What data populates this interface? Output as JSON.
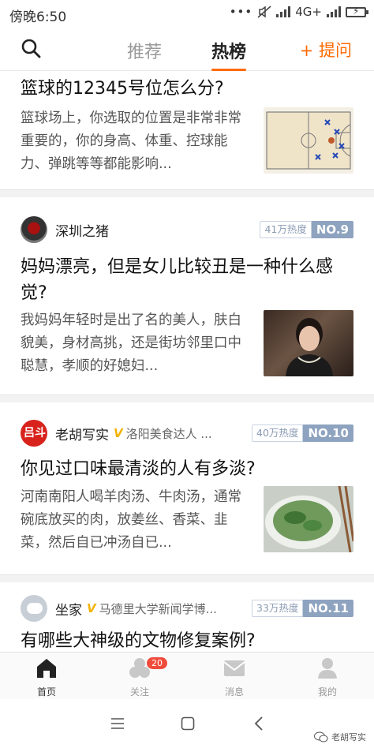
{
  "status_bar": {
    "time": "傍晚6:50",
    "network": "4G+"
  },
  "top_nav": {
    "tabs": [
      {
        "label": "推荐",
        "active": false
      },
      {
        "label": "热榜",
        "active": true
      }
    ],
    "ask_button": "+ 提问",
    "accent_color": "#ff6a00"
  },
  "feed": [
    {
      "title": "篮球的12345号位怎么分?",
      "excerpt": "篮球场上，你选取的位置是非常非常重要的，你的身高、体重、控球能力、弹跳等等都能影响...",
      "thumbnail": "basketball-court-diagram"
    },
    {
      "author": {
        "name": "深圳之猪",
        "verified": false,
        "desc": ""
      },
      "heat": {
        "value": "41万热度",
        "rank": "NO.9"
      },
      "title": "妈妈漂亮，但是女儿比较丑是一种什么感觉?",
      "excerpt": "我妈妈年轻时是出了名的美人，肤白貌美，身材高挑，还是街坊邻里口中聪慧，孝顺的好媳妇...",
      "thumbnail": "woman-portrait-photo"
    },
    {
      "author": {
        "name": "老胡写实",
        "verified": true,
        "verified_mark": "V",
        "desc": "洛阳美食达人 ..."
      },
      "heat": {
        "value": "40万热度",
        "rank": "NO.10"
      },
      "title": "你见过口味最清淡的人有多淡?",
      "excerpt": "河南南阳人喝羊肉汤、牛肉汤，通常碗底放买的肉，放姜丝、香菜、韭菜，然后自已冲汤自已...",
      "thumbnail": "soup-bowl-photo"
    },
    {
      "author": {
        "name": "坐家",
        "verified": true,
        "verified_mark": "V",
        "desc": "马德里大学新闻学博..."
      },
      "heat": {
        "value": "33万热度",
        "rank": "NO.11"
      },
      "title": "有哪些大神级的文物修复案例?"
    }
  ],
  "tab_bar": {
    "items": [
      {
        "label": "首页",
        "icon": "home-icon",
        "active": true
      },
      {
        "label": "关注",
        "icon": "follow-icon",
        "active": false,
        "badge": "20"
      },
      {
        "label": "消息",
        "icon": "message-icon",
        "active": false
      },
      {
        "label": "我的",
        "icon": "profile-icon",
        "active": false
      }
    ]
  },
  "watermark": "老胡写实"
}
